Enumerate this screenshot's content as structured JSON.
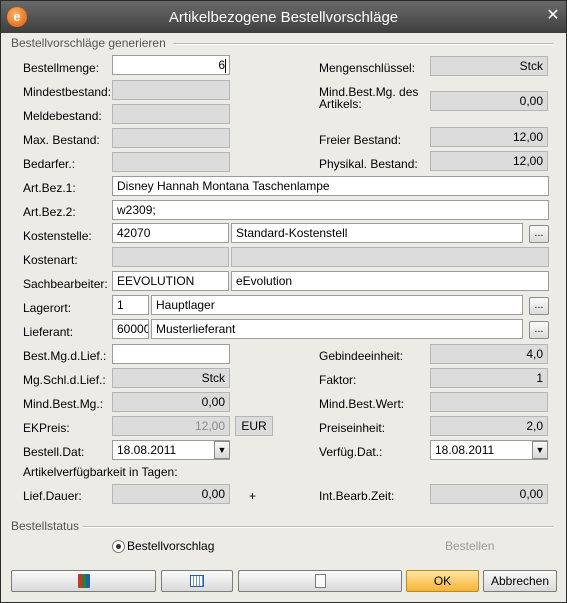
{
  "window": {
    "title": "Artikelbezogene Bestellvorschläge",
    "icon": "e",
    "close_label": "✕"
  },
  "group1": {
    "title": "Bestellvorschläge generieren"
  },
  "left": {
    "bestellmenge": {
      "label": "Bestellmenge:",
      "value": "6"
    },
    "mindestbestand": {
      "label": "Mindestbestand:",
      "value": ""
    },
    "meldebestand": {
      "label": "Meldebestand:",
      "value": ""
    },
    "max_bestand": {
      "label": "Max. Bestand:",
      "value": ""
    },
    "bedarfer": {
      "label": "Bedarfer.:",
      "value": ""
    }
  },
  "right": {
    "mengenschluessel": {
      "label": "Mengenschlüssel:",
      "value": "Stck"
    },
    "mind_best_mg_line1": "Mind.Best.Mg. des",
    "mind_best_mg_line2": "Artikels:",
    "mind_best_mg_value": "0,00",
    "freier_bestand": {
      "label": "Freier Bestand:",
      "value": "12,00"
    },
    "physikal_bestand": {
      "label": "Physikal. Bestand:",
      "value": "12,00"
    }
  },
  "art_bez_1": {
    "label": "Art.Bez.1:",
    "value": "Disney Hannah Montana Taschenlampe"
  },
  "art_bez_2": {
    "label": "Art.Bez.2:",
    "value": "w2309;"
  },
  "kostenstelle": {
    "label": "Kostenstelle:",
    "code": "42070",
    "name": "Standard-Kostenstell"
  },
  "kostenart": {
    "label": "Kostenart:",
    "code": "",
    "name": ""
  },
  "sachbearbeiter": {
    "label": "Sachbearbeiter:",
    "code": "EEVOLUTION",
    "name": "eEvolution"
  },
  "lagerort": {
    "label": "Lagerort:",
    "code": "1",
    "name": "Hauptlager"
  },
  "lieferant": {
    "label": "Lieferant:",
    "code": "60000",
    "name": "Musterlieferant"
  },
  "browse_label": "...",
  "best_mg_lief": {
    "label": "Best.Mg.d.Lief.:",
    "value": ""
  },
  "mg_schl_lief": {
    "label": "Mg.Schl.d.Lief.:",
    "value": "Stck"
  },
  "mind_best_mg": {
    "label": "Mind.Best.Mg.:",
    "value": "0,00"
  },
  "ekpreis": {
    "label": "EKPreis:",
    "value": "12,00",
    "currency": "EUR"
  },
  "bestell_dat": {
    "label": "Bestell.Dat:",
    "value": "18.08.2011"
  },
  "gebindeeinheit": {
    "label": "Gebindeeinheit:",
    "value": "4,0"
  },
  "faktor": {
    "label": "Faktor:",
    "value": "1"
  },
  "mind_best_wert": {
    "label": "Mind.Best.Wert:",
    "value": ""
  },
  "preiseinheit": {
    "label": "Preiseinheit:",
    "value": "2,0"
  },
  "verfueg_dat": {
    "label": "Verfüg.Dat.:",
    "value": "18.08.2011"
  },
  "verfuegbarkeit_heading": "Artikelverfügbarkeit in Tagen:",
  "lief_dauer": {
    "label": "Lief.Dauer:",
    "value": "0,00"
  },
  "plus_sign": "+",
  "int_bearb_zeit": {
    "label": "Int.Bearb.Zeit:",
    "value": "0,00"
  },
  "group2": {
    "title": "Bestellstatus"
  },
  "status": {
    "option_label": "Bestellvorschlag",
    "bestellen_label": "Bestellen"
  },
  "buttons": {
    "ok": "OK",
    "cancel": "Abbrechen"
  },
  "icons": {
    "ddl": "▼",
    "btn1_icon": "calculator-icon",
    "btn2_icon": "calendar-icon",
    "btn3_icon": "document-icon"
  }
}
